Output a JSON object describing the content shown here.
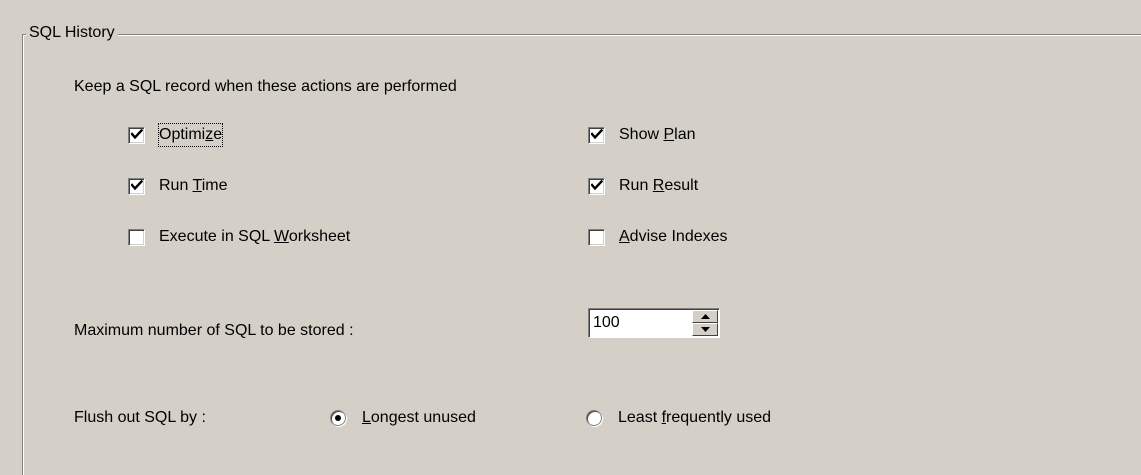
{
  "group": {
    "title": "SQL History"
  },
  "intro_text": "Keep a SQL record when these actions are performed",
  "actions": [
    {
      "id": "optimize",
      "pre": "",
      "key": "",
      "post": "Optimize",
      "underline_index": 7,
      "label": "Optimize",
      "checked": true,
      "focused": true
    },
    {
      "id": "show-plan",
      "pre": "Show ",
      "key": "P",
      "post": "lan",
      "checked": true
    },
    {
      "id": "run-time",
      "pre": "Run ",
      "key": "T",
      "post": "ime",
      "checked": true
    },
    {
      "id": "run-result",
      "pre": "Run ",
      "key": "R",
      "post": "esult",
      "checked": true
    },
    {
      "id": "execute-worksheet",
      "pre": "Execute in SQL ",
      "key": "W",
      "post": "orksheet",
      "checked": false
    },
    {
      "id": "advise-indexes",
      "pre": "",
      "key": "A",
      "post": "dvise Indexes",
      "checked": false
    }
  ],
  "optimize_label": {
    "pre": "Optimi",
    "key": "z",
    "post": "e"
  },
  "max_sql": {
    "label": "Maximum number of SQL to be stored :",
    "value": "100"
  },
  "flush": {
    "label": "Flush out SQL by :",
    "options": [
      {
        "id": "longest-unused",
        "pre": "",
        "key": "L",
        "post": "ongest unused",
        "selected": true
      },
      {
        "id": "least-frequently-used",
        "pre": "Least ",
        "key": "f",
        "post": "requently used",
        "selected": false
      }
    ]
  },
  "icons": {
    "check": "checkmark-icon",
    "spin_up": "arrow-up-icon",
    "spin_down": "arrow-down-icon",
    "radio_dot": "radio-dot-icon"
  },
  "colors": {
    "face": "#d4d0c8",
    "shadow": "#808080",
    "dark_shadow": "#404040",
    "highlight": "#ffffff"
  }
}
